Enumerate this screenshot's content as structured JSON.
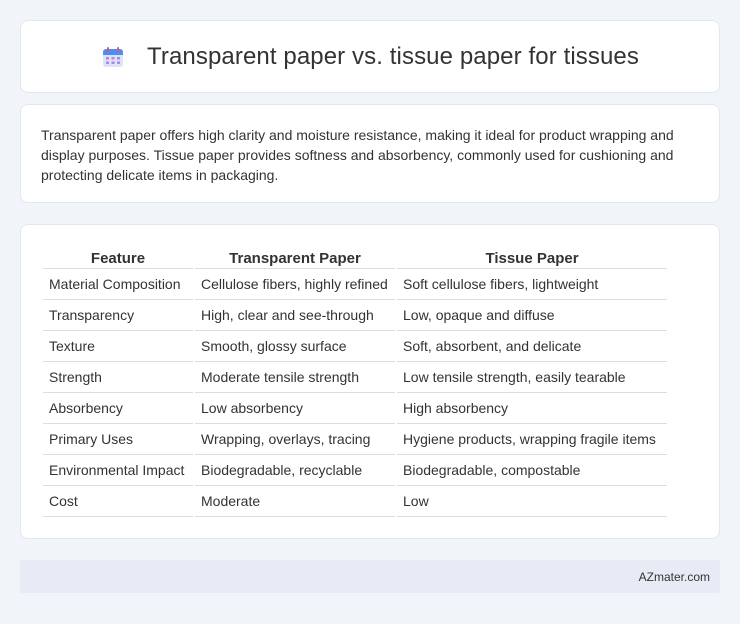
{
  "header": {
    "icon": "calendar-icon",
    "title": "Transparent paper vs. tissue paper for tissues"
  },
  "summary": {
    "text": "Transparent paper offers high clarity and moisture resistance, making it ideal for product wrapping and display purposes. Tissue paper provides softness and absorbency, commonly used for cushioning and protecting delicate items in packaging."
  },
  "table": {
    "headers": [
      "Feature",
      "Transparent Paper",
      "Tissue Paper"
    ],
    "rows": [
      [
        "Material Composition",
        "Cellulose fibers, highly refined",
        "Soft cellulose fibers, lightweight"
      ],
      [
        "Transparency",
        "High, clear and see-through",
        "Low, opaque and diffuse"
      ],
      [
        "Texture",
        "Smooth, glossy surface",
        "Soft, absorbent, and delicate"
      ],
      [
        "Strength",
        "Moderate tensile strength",
        "Low tensile strength, easily tearable"
      ],
      [
        "Absorbency",
        "Low absorbency",
        "High absorbency"
      ],
      [
        "Primary Uses",
        "Wrapping, overlays, tracing",
        "Hygiene products, wrapping fragile items"
      ],
      [
        "Environmental Impact",
        "Biodegradable, recyclable",
        "Biodegradable, compostable"
      ],
      [
        "Cost",
        "Moderate",
        "Low"
      ]
    ]
  },
  "footer": {
    "text": "AZmater.com"
  }
}
